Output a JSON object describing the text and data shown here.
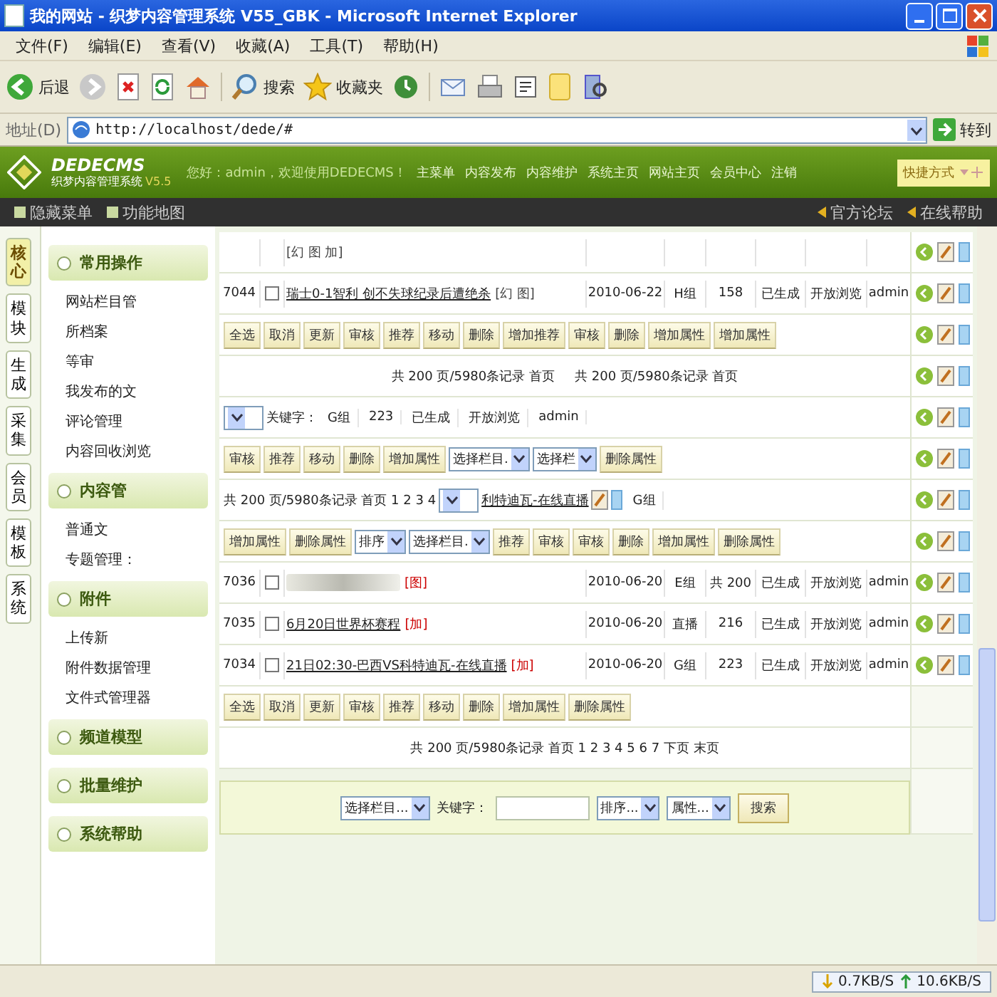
{
  "window": {
    "title": "我的网站 - 织梦内容管理系统 V55_GBK - Microsoft Internet Explorer"
  },
  "menu_bar": [
    "文件(F)",
    "编辑(E)",
    "查看(V)",
    "收藏(A)",
    "工具(T)",
    "帮助(H)"
  ],
  "toolbar": [
    {
      "kind": "back",
      "label": "后退"
    },
    {
      "kind": "forward"
    },
    {
      "kind": "stop"
    },
    {
      "kind": "refresh"
    },
    {
      "kind": "home"
    },
    {
      "kind": "search",
      "label": "搜索"
    },
    {
      "kind": "favorites",
      "label": "收藏夹"
    },
    {
      "kind": "history"
    },
    {
      "kind": "mail"
    },
    {
      "kind": "print"
    },
    {
      "kind": "edit"
    },
    {
      "kind": "note"
    },
    {
      "kind": "research"
    }
  ],
  "address_bar": {
    "label": "地址(D)",
    "value": "http://localhost/dede/#",
    "go": "转到"
  },
  "cms_header": {
    "logo": "DEDECMS",
    "subtitle": "织梦内容管理系统",
    "version": "V5.5",
    "greeting": "您好：admin，欢迎使用DEDECMS！",
    "nav": [
      "主菜单",
      "内容发布",
      "内容维护",
      "系统主页",
      "网站主页",
      "会员中心",
      "注销"
    ],
    "quick_menu": "快捷方式"
  },
  "sub_bar": {
    "left": [
      "隐藏菜单",
      "功能地图"
    ],
    "right": [
      "官方论坛",
      "在线帮助"
    ]
  },
  "side_tabs": [
    {
      "label": "核心",
      "selected": true
    },
    {
      "label": "模块",
      "selected": false
    },
    {
      "label": "生成",
      "selected": false
    },
    {
      "label": "采集",
      "selected": false
    },
    {
      "label": "会员",
      "selected": false
    },
    {
      "label": "模板",
      "selected": false
    },
    {
      "label": "系统",
      "selected": false
    }
  ],
  "side_menu": [
    {
      "title": "常用操作",
      "items": [
        "网站栏目管",
        "所档案",
        "等审",
        "我发布的文",
        "评论管理",
        "内容回收浏览"
      ]
    },
    {
      "title": "内容管",
      "items": [
        "普通文",
        "专题管理："
      ]
    },
    {
      "title": "附件",
      "items": [
        "上传新",
        "附件数据管理",
        "文件式管理器"
      ]
    },
    {
      "title": "频道模型"
    },
    {
      "title": "批量维护"
    },
    {
      "title": "系统帮助"
    }
  ],
  "main": [
    {
      "kind": "row",
      "actions": true,
      "title": {
        "kind": "none"
      },
      "tags": {
        "text": "[幻 图 加]",
        "color": "#444444"
      }
    },
    {
      "kind": "row",
      "actions": true,
      "id": "7044",
      "checked": false,
      "title": {
        "kind": "text",
        "text": "瑞士0-1智利 创不失球纪录后遭绝杀"
      },
      "tags": {
        "text": "[幻 图]",
        "color": "#444444"
      },
      "date": "2010-06-22",
      "group": "H组",
      "clicks": "158",
      "status": "已生成",
      "access": "开放浏览",
      "author": "admin"
    },
    {
      "kind": "bar",
      "actions": true,
      "parts": [
        {
          "kind": "button",
          "text": "全选"
        },
        {
          "kind": "button",
          "text": "取消"
        },
        {
          "kind": "button",
          "text": "更新"
        },
        {
          "kind": "button",
          "text": "审核"
        },
        {
          "kind": "button",
          "text": "推荐"
        },
        {
          "kind": "button",
          "text": "移动"
        },
        {
          "kind": "button",
          "text": "删除"
        },
        {
          "kind": "button",
          "text": "增加推荐"
        },
        {
          "kind": "button",
          "text": "审核"
        },
        {
          "kind": "button",
          "text": "删除"
        },
        {
          "kind": "button",
          "text": "增加属性"
        },
        {
          "kind": "button",
          "text": "增加属性"
        }
      ]
    },
    {
      "kind": "pager",
      "actions": true,
      "parts": [
        {
          "kind": "text",
          "text": "共 200 页/5980条记录 首页"
        },
        {
          "kind": "text",
          "text": "共 200 页/5980条记录 首页"
        }
      ]
    },
    {
      "kind": "bar",
      "actions": true,
      "parts": [
        {
          "kind": "select"
        },
        {
          "kind": "label",
          "text": "关键字："
        },
        {
          "kind": "cell",
          "text": "G组"
        },
        {
          "kind": "cell",
          "text": "223"
        },
        {
          "kind": "cell",
          "text": "已生成"
        },
        {
          "kind": "cell",
          "text": "开放浏览"
        },
        {
          "kind": "cell",
          "text": "admin"
        }
      ]
    },
    {
      "kind": "bar",
      "actions": true,
      "parts": [
        {
          "kind": "button",
          "text": "审核"
        },
        {
          "kind": "button",
          "text": "推荐"
        },
        {
          "kind": "button",
          "text": "移动"
        },
        {
          "kind": "button",
          "text": "删除"
        },
        {
          "kind": "button",
          "text": "增加属性"
        },
        {
          "kind": "select",
          "text": "选择栏目."
        },
        {
          "kind": "select",
          "text": "选择栏"
        },
        {
          "kind": "button",
          "text": "删除属性"
        }
      ]
    },
    {
      "kind": "bar",
      "actions": true,
      "parts": [
        {
          "kind": "text",
          "text": "共 200 页/5980条记录 首页 1 2 3 4"
        },
        {
          "kind": "select"
        },
        {
          "kind": "link",
          "text": "利特迪瓦-在线直播"
        },
        {
          "kind": "tool-icons"
        },
        {
          "kind": "cell",
          "text": "G组"
        }
      ]
    },
    {
      "kind": "bar",
      "actions": true,
      "parts": [
        {
          "kind": "button",
          "text": "增加属性"
        },
        {
          "kind": "button",
          "text": "删除属性"
        },
        {
          "kind": "select",
          "text": "排序"
        },
        {
          "kind": "select",
          "text": "选择栏目."
        },
        {
          "kind": "button",
          "text": "推荐"
        },
        {
          "kind": "button",
          "text": "审核"
        },
        {
          "kind": "button",
          "text": "审核"
        },
        {
          "kind": "button",
          "text": "删除"
        },
        {
          "kind": "button",
          "text": "增加属性"
        },
        {
          "kind": "button",
          "text": "删除属性"
        }
      ]
    },
    {
      "kind": "row",
      "actions": true,
      "id": "7036",
      "checked": false,
      "title": {
        "kind": "picture"
      },
      "tags": {
        "text": "[图]",
        "color": "#cc0000"
      },
      "date": "2010-06-20",
      "group": "E组",
      "clicks": "共 200",
      "status": "已生成",
      "access": "开放浏览",
      "author": "admin"
    },
    {
      "kind": "row",
      "actions": true,
      "id": "7035",
      "checked": false,
      "title": {
        "kind": "text",
        "text": "6月20日世界杯赛程"
      },
      "tags": {
        "text": "[加]",
        "color": "#cc0000"
      },
      "date": "2010-06-20",
      "group": "直播",
      "clicks": "216",
      "status": "已生成",
      "access": "开放浏览",
      "author": "admin"
    },
    {
      "kind": "row",
      "actions": true,
      "id": "7034",
      "checked": false,
      "title": {
        "kind": "text",
        "text": "21日02:30-巴西VS科特迪瓦-在线直播"
      },
      "tags": {
        "text": "[加]",
        "color": "#cc0000"
      },
      "date": "2010-06-20",
      "group": "G组",
      "clicks": "223",
      "status": "已生成",
      "access": "开放浏览",
      "author": "admin"
    },
    {
      "kind": "bar",
      "actions": false,
      "parts": [
        {
          "kind": "button",
          "text": "全选"
        },
        {
          "kind": "button",
          "text": "取消"
        },
        {
          "kind": "button",
          "text": "更新"
        },
        {
          "kind": "button",
          "text": "审核"
        },
        {
          "kind": "button",
          "text": "推荐"
        },
        {
          "kind": "button",
          "text": "移动"
        },
        {
          "kind": "button",
          "text": "删除"
        },
        {
          "kind": "button",
          "text": "增加属性"
        },
        {
          "kind": "button",
          "text": "删除属性"
        }
      ]
    },
    {
      "kind": "pager",
      "actions": false,
      "parts": [
        {
          "kind": "text",
          "text": "共 200 页/5980条记录 首页 1 2 3 4 5 6 7 下页 末页"
        }
      ]
    },
    {
      "kind": "search",
      "actions": false,
      "parts": [
        {
          "kind": "select",
          "text": "选择栏目..."
        },
        {
          "kind": "label",
          "text": "关键字："
        },
        {
          "kind": "input"
        },
        {
          "kind": "select",
          "text": "排序..."
        },
        {
          "kind": "select",
          "text": "属性..."
        },
        {
          "kind": "button",
          "text": "搜索"
        }
      ]
    }
  ],
  "status_bar": {
    "download": "0.7KB/S",
    "upload": "10.6KB/S"
  }
}
